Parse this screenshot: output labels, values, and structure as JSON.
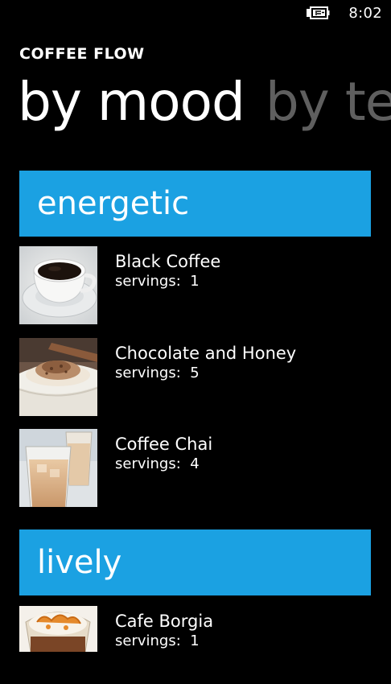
{
  "status_bar": {
    "time": "8:02",
    "battery_icon": "battery-charging-icon"
  },
  "app": {
    "title": "COFFEE FLOW"
  },
  "pivot": {
    "active": "by mood",
    "next": "by te"
  },
  "groups": [
    {
      "header": "energetic",
      "items": [
        {
          "name": "Black Coffee",
          "servings_label": "servings:",
          "servings": "1",
          "thumb_icon": "black-coffee-photo"
        },
        {
          "name": "Chocolate and Honey",
          "servings_label": "servings:",
          "servings": "5",
          "thumb_icon": "chocolate-honey-photo"
        },
        {
          "name": "Coffee Chai",
          "servings_label": "servings:",
          "servings": "4",
          "thumb_icon": "coffee-chai-photo"
        }
      ]
    },
    {
      "header": "lively",
      "items": [
        {
          "name": "Cafe Borgia",
          "servings_label": "servings:",
          "servings": "1",
          "thumb_icon": "cafe-borgia-photo"
        }
      ]
    }
  ],
  "colors": {
    "accent": "#1ba1e2",
    "background": "#000000",
    "inactive_pivot": "#5f5f5f"
  }
}
